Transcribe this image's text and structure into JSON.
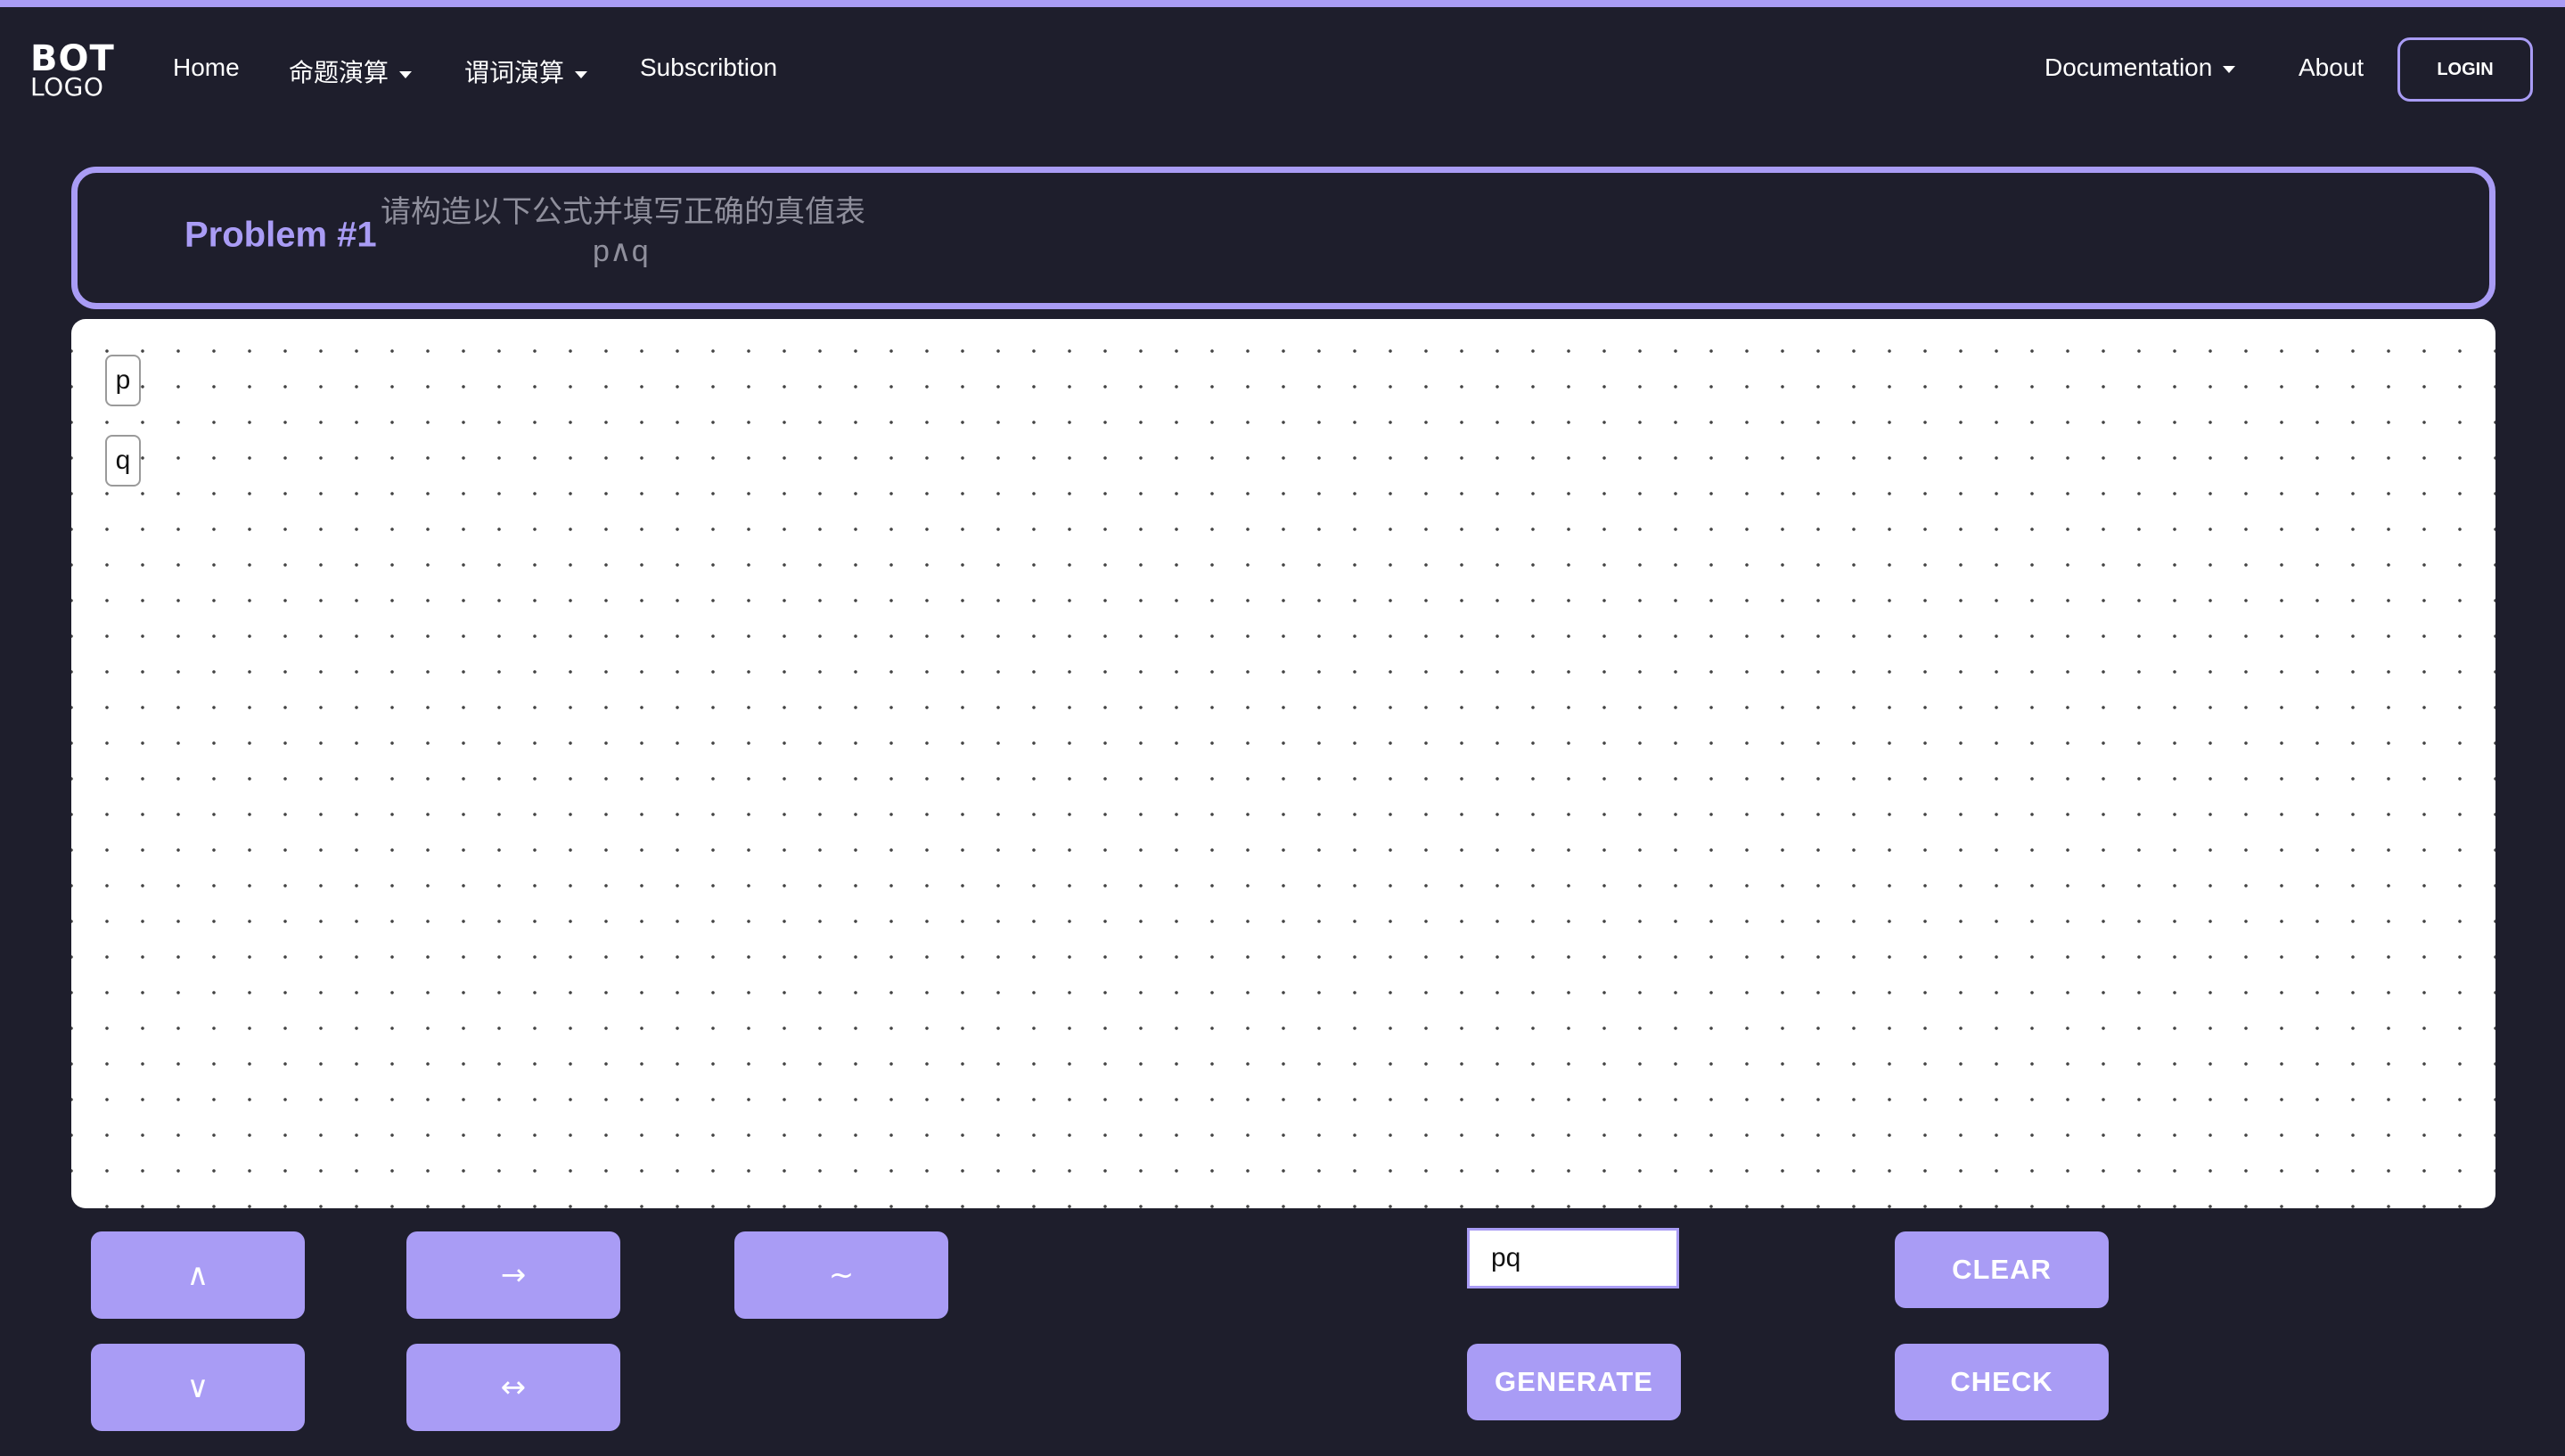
{
  "nav": {
    "logo_top": "BOT",
    "logo_bottom": "LOGO",
    "home": "Home",
    "propositional": "命题演算",
    "predicate": "谓词演算",
    "subscription": "Subscribtion",
    "documentation": "Documentation",
    "about": "About",
    "login": "LOGIN"
  },
  "problem": {
    "title": "Problem #1",
    "description": "请构造以下公式并填写正确的真值表",
    "formula": "p∧q"
  },
  "canvas": {
    "variables": [
      "p",
      "q"
    ]
  },
  "operators": {
    "and": "∧",
    "or": "∨",
    "implies": "→",
    "iff": "↔",
    "not": "~"
  },
  "input": {
    "value": "pq"
  },
  "actions": {
    "clear": "CLEAR",
    "generate": "GENERATE",
    "check": "CHECK"
  },
  "colors": {
    "background": "#1e1e2c",
    "accent": "#a99cf5"
  }
}
